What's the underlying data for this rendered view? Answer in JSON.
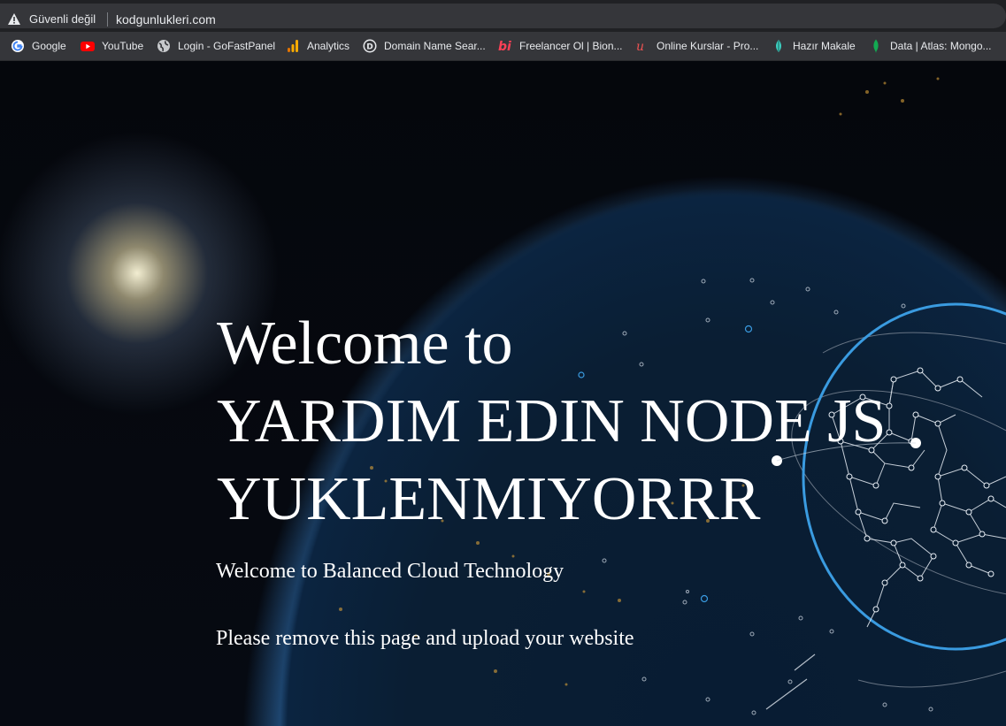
{
  "browser": {
    "security_label": "Güvenli değil",
    "url": "kodgunlukleri.com",
    "bookmarks": [
      {
        "label": "Google",
        "icon": "google-icon"
      },
      {
        "label": "YouTube",
        "icon": "youtube-icon"
      },
      {
        "label": "Login - GoFastPanel",
        "icon": "globe-icon"
      },
      {
        "label": "Analytics",
        "icon": "analytics-icon"
      },
      {
        "label": "Domain Name Sear...",
        "icon": "d-letter-icon"
      },
      {
        "label": "Freelancer Ol | Bion...",
        "icon": "bi-logo-icon"
      },
      {
        "label": "Online Kurslar - Pro...",
        "icon": "udemy-icon"
      },
      {
        "label": "Hazır Makale",
        "icon": "leaf-icon"
      },
      {
        "label": "Data | Atlas: Mongo...",
        "icon": "mongodb-leaf-icon"
      }
    ]
  },
  "page": {
    "headline_line1": "Welcome to",
    "headline_line2": "YARDIM EDIN NODE JS",
    "headline_line3": "YUKLENMIYORRR",
    "subtitle": "Welcome to Balanced Cloud Technology",
    "instruction": "Please remove this page and upload your website"
  },
  "colors": {
    "accent_blue": "#3a9be0",
    "background": "#05070c"
  }
}
